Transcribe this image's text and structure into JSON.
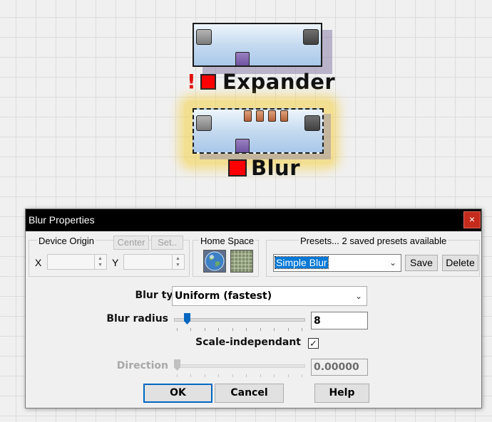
{
  "graph": {
    "nodes": [
      {
        "label": "Expander",
        "warning": "!"
      },
      {
        "label": "Blur"
      }
    ]
  },
  "dialog": {
    "title": "Blur Properties",
    "close_label": "×",
    "device_origin": {
      "label": "Device Origin",
      "center_label": "Center",
      "set_label": "Set..",
      "x_label": "X",
      "y_label": "Y",
      "x_value": "",
      "y_value": ""
    },
    "home_space": {
      "label": "Home Space",
      "buttons": [
        "globe-icon",
        "grid-icon"
      ]
    },
    "presets": {
      "label": "Presets... 2 saved presets available",
      "selected": "Simple Blur",
      "save_label": "Save",
      "delete_label": "Delete"
    },
    "blur_type": {
      "label": "Blur type",
      "value": "Uniform (fastest)"
    },
    "blur_radius": {
      "label": "Blur radius",
      "value": "8",
      "slider_fraction": 0.08
    },
    "scale_independant": {
      "label": "Scale-independant",
      "checked": true
    },
    "direction": {
      "label": "Direction",
      "value": "0.00000",
      "slider_fraction": 0.0,
      "disabled": true
    },
    "buttons": {
      "ok": "OK",
      "cancel": "Cancel",
      "help": "Help"
    }
  },
  "colors": {
    "accent": "#0067c0",
    "close": "#c42b1c",
    "status_red": "#ff0000",
    "selection_glow": "#f5d246",
    "port_purple": "#7e64b0"
  }
}
